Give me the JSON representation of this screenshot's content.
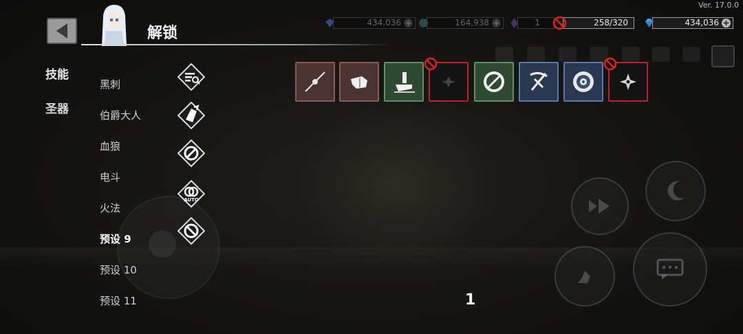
{
  "version": "Ver. 17.0.0",
  "header": {
    "title": "解锁"
  },
  "resources": {
    "res1": {
      "value": "434,036"
    },
    "res2": {
      "value": "164,938"
    },
    "res3": {
      "value": "1"
    },
    "stamina": {
      "value": "258/320"
    },
    "gems": {
      "value": "434,036"
    }
  },
  "categories": [
    {
      "label": "技能"
    },
    {
      "label": "圣器"
    }
  ],
  "presets": [
    {
      "label": "黑刺"
    },
    {
      "label": "伯爵大人"
    },
    {
      "label": "血狼"
    },
    {
      "label": "电斗"
    },
    {
      "label": "火法"
    },
    {
      "label": "预设 9"
    },
    {
      "label": "预设 10"
    },
    {
      "label": "预设 11"
    }
  ],
  "skills": [
    {
      "name": "cross-slash-icon",
      "color": "brown",
      "locked": false
    },
    {
      "name": "fist-icon",
      "color": "brown",
      "locked": false
    },
    {
      "name": "hand-dash-icon",
      "color": "green",
      "locked": false
    },
    {
      "name": "dark-spark-icon",
      "color": "red",
      "locked": true
    },
    {
      "name": "ring-blade-icon",
      "color": "green",
      "locked": false
    },
    {
      "name": "crossbow-icon",
      "color": "blue",
      "locked": false
    },
    {
      "name": "vortex-icon",
      "color": "blue",
      "locked": false
    },
    {
      "name": "shuriken-icon",
      "color": "red",
      "locked": true
    }
  ],
  "pagination": {
    "current": "1"
  },
  "colors": {
    "locked": "#c0202a",
    "brown": "#8a5a56",
    "green": "#5f8f62",
    "blue": "#5b79a8"
  }
}
